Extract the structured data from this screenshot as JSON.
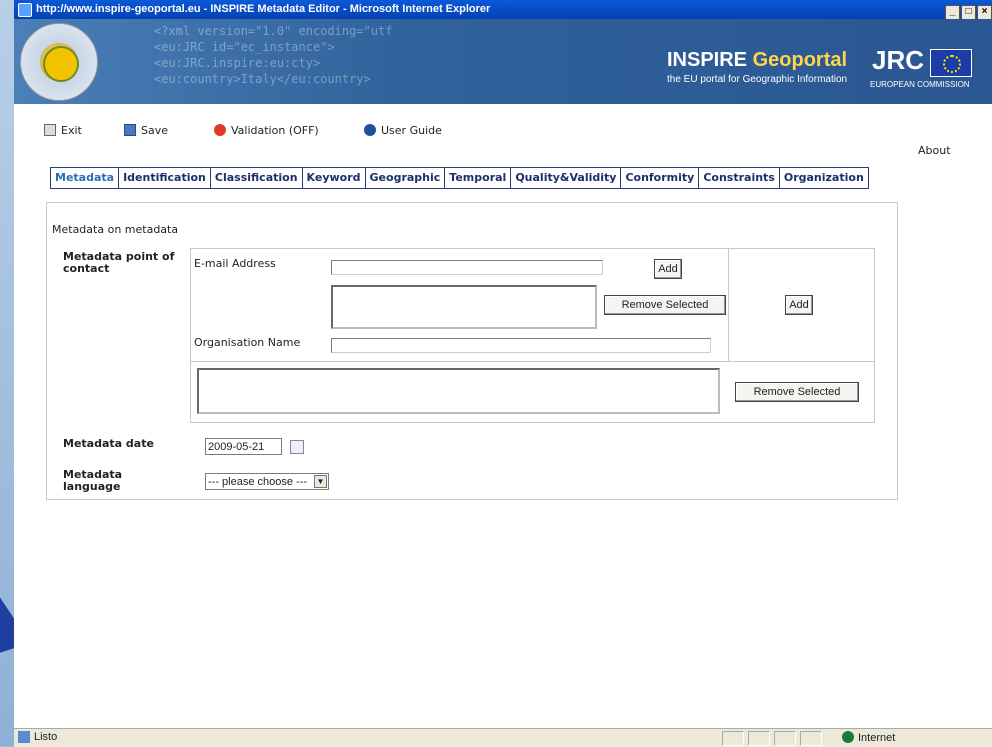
{
  "window": {
    "title": "http://www.inspire-geoportal.eu - INSPIRE Metadata Editor - Microsoft Internet Explorer",
    "buttons": [
      "_",
      "□",
      "×"
    ]
  },
  "banner": {
    "xml_lines": [
      "<?xml version=\"1.0\" encoding=\"utf",
      "<eu:JRC id=\"ec_instance\">",
      "<eu:JRC.inspire:eu:cty>",
      "<eu:country>Italy</eu:country>"
    ],
    "brand_main": "INSPIRE",
    "brand_geo": "Geoportal",
    "brand_sub": "the EU portal for Geographic Information",
    "jrc": "JRC",
    "commission": "EUROPEAN COMMISSION"
  },
  "toolbar": {
    "exit": "Exit",
    "save": "Save",
    "validation": "Validation (OFF)",
    "guide": "User Guide"
  },
  "about": "About",
  "tabs": [
    "Metadata",
    "Identification",
    "Classification",
    "Keyword",
    "Geographic",
    "Temporal",
    "Quality&Validity",
    "Conformity",
    "Constraints",
    "Organization"
  ],
  "form": {
    "section_title": "Metadata on metadata",
    "contact_label": "Metadata point of contact",
    "email_label": "E-mail Address",
    "email_value": "",
    "org_label": "Organisation Name",
    "org_value": "",
    "add_label": "Add",
    "remove_label": "Remove Selected",
    "date_label": "Metadata date",
    "date_value": "2009-05-21",
    "language_label": "Metadata language",
    "language_value": "--- please choose ---"
  },
  "status": {
    "left": "Listo",
    "zone": "Internet"
  }
}
